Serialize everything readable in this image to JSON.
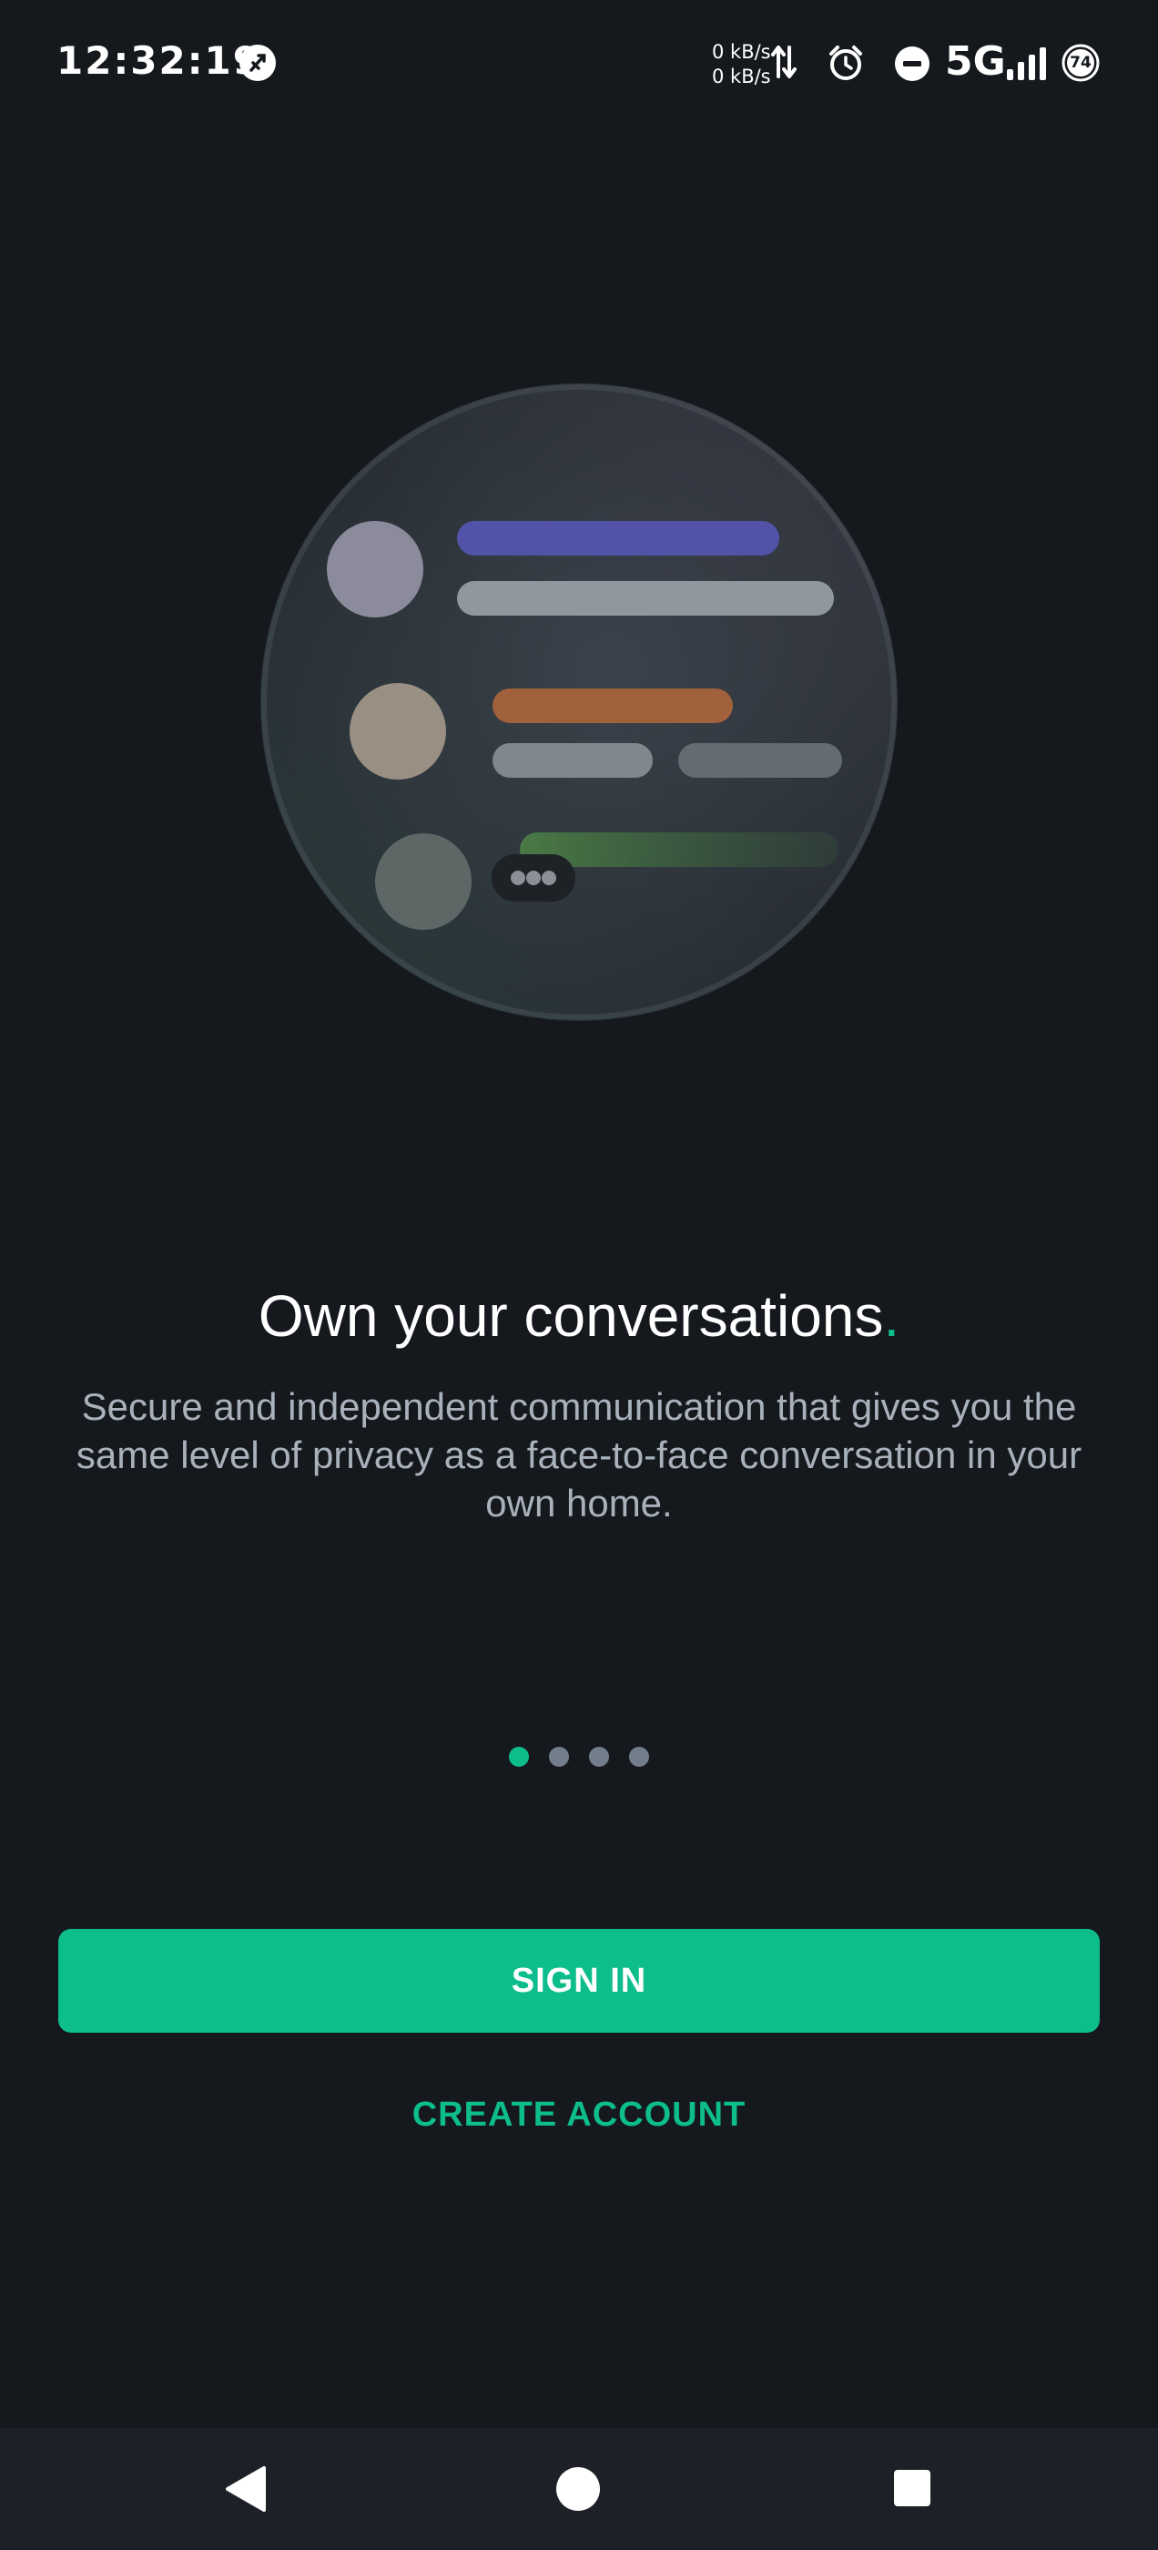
{
  "status_bar": {
    "time": "12:32:19",
    "net_speed_up": "0 kB/s",
    "net_speed_down": "0 kB/s",
    "network_type": "5G",
    "battery_level": "74",
    "icons": [
      "app-notification-icon",
      "data-arrows-icon",
      "alarm-icon",
      "do-not-disturb-icon",
      "signal-icon",
      "battery-icon"
    ]
  },
  "onboarding": {
    "headline": "Own your conversations",
    "headline_dot": ".",
    "subtitle": "Secure and independent communication that gives you the same level of privacy as a face-to-face conversation in your own home.",
    "page_count": 4,
    "current_page": 1
  },
  "actions": {
    "sign_in_label": "SIGN IN",
    "create_account_label": "CREATE ACCOUNT"
  },
  "colors": {
    "background": "#15191e",
    "accent": "#0dbd8b",
    "secondary_text": "#a9b2bc",
    "inactive_dot": "#737d8c"
  },
  "nav_bar": {
    "icons": [
      "back-icon",
      "home-icon",
      "recents-icon"
    ]
  }
}
